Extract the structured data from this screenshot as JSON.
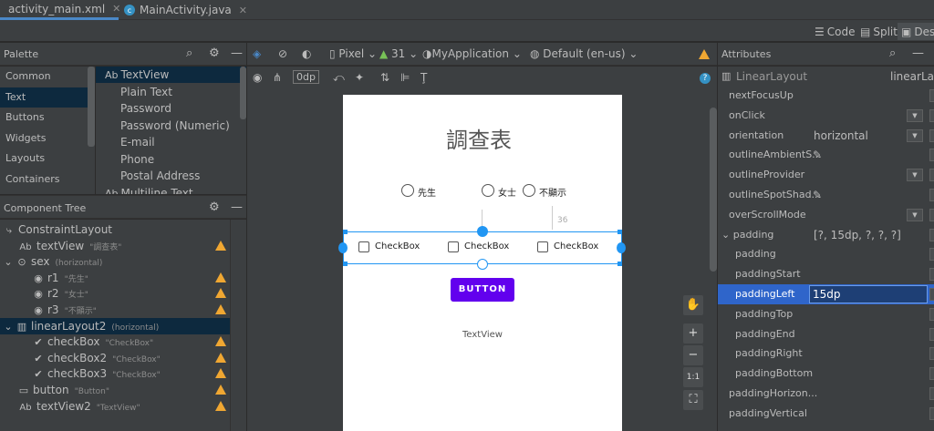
{
  "tabs": [
    {
      "label": "activity_main.xml",
      "active": true
    },
    {
      "label": "MainActivity.java",
      "active": false
    }
  ],
  "view_modes": {
    "code": "Code",
    "split": "Split",
    "design": "Desi"
  },
  "palette": {
    "title": "Palette",
    "categories": [
      "Common",
      "Text",
      "Buttons",
      "Widgets",
      "Layouts",
      "Containers"
    ],
    "selected_category": "Text",
    "items": [
      {
        "prefix": "Ab",
        "label": "TextView"
      },
      {
        "prefix": "",
        "label": "Plain Text"
      },
      {
        "prefix": "",
        "label": "Password"
      },
      {
        "prefix": "",
        "label": "Password (Numeric)"
      },
      {
        "prefix": "",
        "label": "E-mail"
      },
      {
        "prefix": "",
        "label": "Phone"
      },
      {
        "prefix": "",
        "label": "Postal Address"
      },
      {
        "prefix": "Ab",
        "label": "Multiline Text"
      }
    ]
  },
  "component_tree": {
    "title": "Component Tree",
    "rows": [
      {
        "label": "ConstraintLayout",
        "sub": "",
        "warn": false
      },
      {
        "label": "textView",
        "sub": "\"調查表\"",
        "warn": true
      },
      {
        "label": "sex",
        "sub": "(horizontal)",
        "warn": false
      },
      {
        "label": "r1",
        "sub": "\"先生\"",
        "warn": true
      },
      {
        "label": "r2",
        "sub": "\"女士\"",
        "warn": true
      },
      {
        "label": "r3",
        "sub": "\"不顯示\"",
        "warn": true
      },
      {
        "label": "linearLayout2",
        "sub": "(horizontal)",
        "warn": false
      },
      {
        "label": "checkBox",
        "sub": "\"CheckBox\"",
        "warn": true
      },
      {
        "label": "checkBox2",
        "sub": "\"CheckBox\"",
        "warn": true
      },
      {
        "label": "checkBox3",
        "sub": "\"CheckBox\"",
        "warn": true
      },
      {
        "label": "button",
        "sub": "\"Button\"",
        "warn": true
      },
      {
        "label": "textView2",
        "sub": "\"TextView\"",
        "warn": true
      }
    ]
  },
  "design_toolbar": {
    "device": "Pixel",
    "api": "31",
    "theme": "MyApplication",
    "locale": "Default (en-us)",
    "margin": "0dp"
  },
  "phone": {
    "title": "調查表",
    "radios": [
      "先生",
      "女士",
      "不顯示"
    ],
    "checkboxes": [
      "CheckBox",
      "CheckBox",
      "CheckBox"
    ],
    "button": "BUTTON",
    "textview": "TextView",
    "constraint_value": "36"
  },
  "zoom": {
    "fit": "1:1"
  },
  "attributes": {
    "title": "Attributes",
    "widget": "LinearLayout",
    "id": "linearLayo",
    "rows": [
      {
        "name": "nextFocusUp",
        "value": "",
        "control": "none"
      },
      {
        "name": "onClick",
        "value": "",
        "control": "dropdown"
      },
      {
        "name": "orientation",
        "value": "horizontal",
        "control": "dropdown"
      },
      {
        "name": "outlineAmbientS...",
        "value": "",
        "control": "picker"
      },
      {
        "name": "outlineProvider",
        "value": "",
        "control": "dropdown"
      },
      {
        "name": "outlineSpotShad...",
        "value": "",
        "control": "picker"
      },
      {
        "name": "overScrollMode",
        "value": "",
        "control": "dropdown"
      },
      {
        "name": "padding",
        "value": "[?, 15dp, ?, ?, ?]",
        "control": "group"
      },
      {
        "name": "padding",
        "value": "",
        "control": "none"
      },
      {
        "name": "paddingStart",
        "value": "",
        "control": "none"
      },
      {
        "name": "paddingLeft",
        "value": "15dp",
        "control": "edit"
      },
      {
        "name": "paddingTop",
        "value": "",
        "control": "none"
      },
      {
        "name": "paddingEnd",
        "value": "",
        "control": "none"
      },
      {
        "name": "paddingRight",
        "value": "",
        "control": "none"
      },
      {
        "name": "paddingBottom",
        "value": "",
        "control": "none"
      },
      {
        "name": "paddingHorizon...",
        "value": "",
        "control": "none"
      },
      {
        "name": "paddingVertical",
        "value": "",
        "control": "none"
      }
    ]
  },
  "colors": {
    "accent": "#2f65ca",
    "button_purple": "#6200ee",
    "selection_blue": "#2196f3",
    "warning": "#f0a732"
  }
}
